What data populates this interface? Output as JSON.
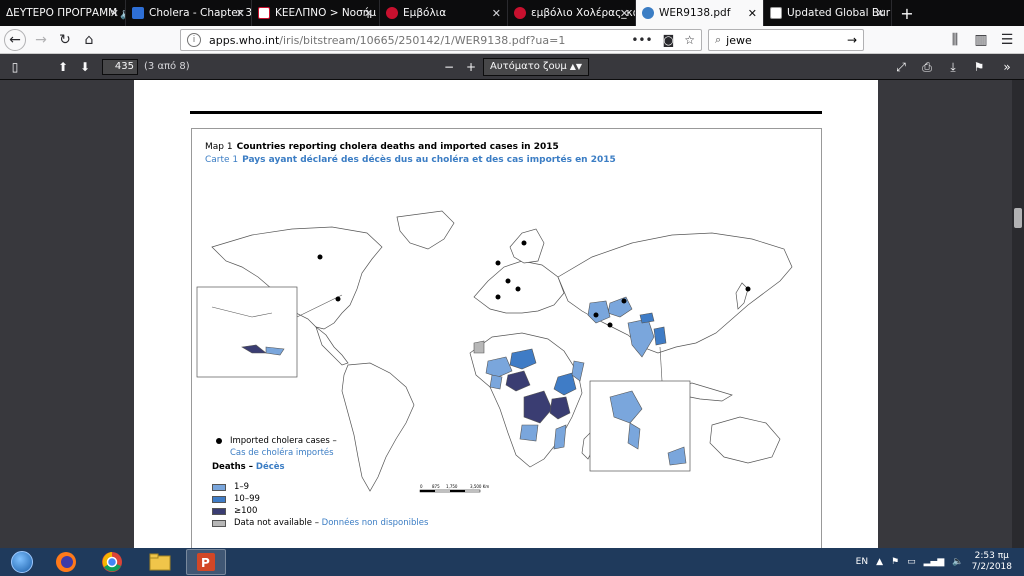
{
  "tabs": [
    {
      "label": "ΔΕΥΤΕΡΟ ΠΡΟΓΡΑΜΜ",
      "color": "#0c0c0d",
      "audio": "🔊"
    },
    {
      "label": "Cholera - Chapter 3",
      "color": "#2e6fd6"
    },
    {
      "label": "ΚΕΕΛΠΝΟ > Νοσήμ",
      "color": "#c8102e"
    },
    {
      "label": "Εμβόλια",
      "color": "#c8102e"
    },
    {
      "label": "εμβόλιο Χολέρας_κα",
      "color": "#c8102e"
    },
    {
      "label": "WER9138.pdf",
      "color": "#3b7dc4"
    },
    {
      "label": "Updated Global Bur",
      "color": "#555"
    }
  ],
  "active_tab": 5,
  "url": {
    "host": "apps.who.int",
    "path": "/iris/bitstream/10665/250142/1/WER9138.pdf?ua=1"
  },
  "search": {
    "value": "jewe"
  },
  "pdf_toolbar": {
    "page_number": "435",
    "page_of": "(3 από 8)",
    "zoom": "Αυτόματο ζουμ"
  },
  "map": {
    "en_prefix": "Map 1",
    "en_title": "Countries reporting cholera deaths and imported cases in 2015",
    "fr_prefix": "Carte 1",
    "fr_title": "Pays ayant déclaré des décès dus au choléra et des cas importés en 2015",
    "colors": {
      "light": "#7aa6dc",
      "medium": "#3f7cc6",
      "dark": "#3a3d72",
      "na": "#b7b7b7"
    },
    "legend": {
      "imported_en": "Imported cholera cases –",
      "imported_fr": "Cas de choléra importés",
      "deaths_en": "Deaths –",
      "deaths_fr": "Décès",
      "bin1": "1–9",
      "bin2": "10–99",
      "bin3": "≥100",
      "na_en": "Data not available –",
      "na_fr": "Données non disponibles"
    },
    "scale": {
      "t0": "0",
      "t1": "875",
      "t2": "1,750",
      "t3": "3,500 Km"
    }
  },
  "taskbar": {
    "lang": "EN",
    "time": "2:53 πμ",
    "date": "7/2/2018",
    "apps": [
      "ie-icon",
      "firefox-icon",
      "chrome-icon",
      "folder-icon",
      "powerpoint-icon"
    ]
  }
}
